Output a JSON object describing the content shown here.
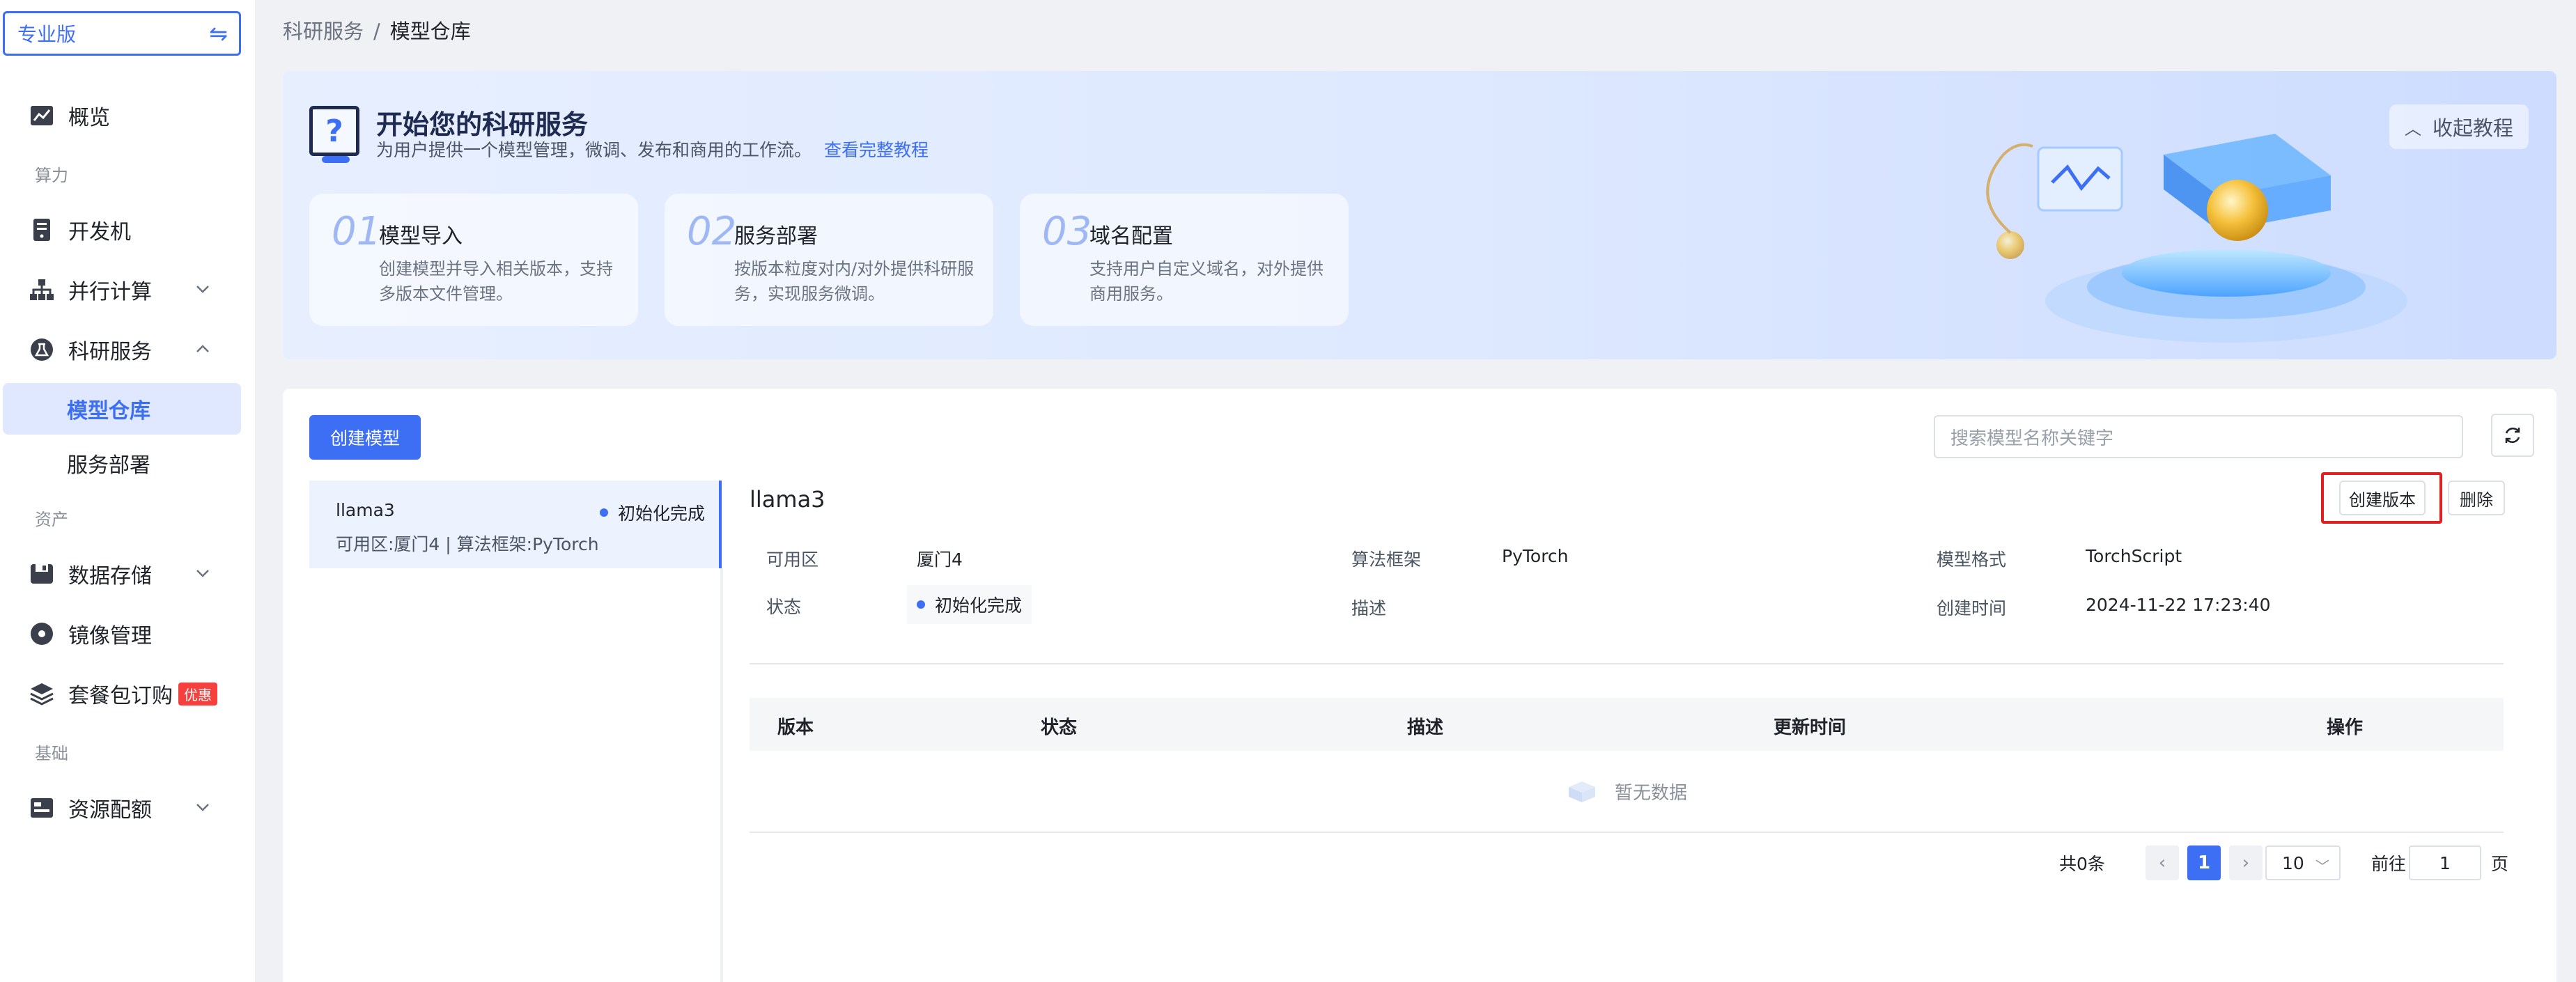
{
  "sidebar": {
    "edition": "专业版",
    "overview": "概览",
    "group_compute": "算力",
    "dev_machine": "开发机",
    "parallel": "并行计算",
    "research": "科研服务",
    "model_repo": "模型仓库",
    "service_deploy": "服务部署",
    "group_assets": "资产",
    "data_storage": "数据存储",
    "image_mgmt": "镜像管理",
    "package": "套餐包订购",
    "package_badge": "优惠",
    "group_basic": "基础",
    "resource_quota": "资源配额"
  },
  "breadcrumb": {
    "parent": "科研服务",
    "sep": "/",
    "current": "模型仓库"
  },
  "banner": {
    "title": "开始您的科研服务",
    "subtitle": "为用户提供一个模型管理，微调、发布和商用的工作流。",
    "tutorial_link": "查看完整教程",
    "collapse": "收起教程",
    "steps": [
      {
        "num": "01",
        "title": "模型导入",
        "desc": "创建模型并导入相关版本，支持多版本文件管理。"
      },
      {
        "num": "02",
        "title": "服务部署",
        "desc": "按版本粒度对内/对外提供科研服务，实现服务微调。"
      },
      {
        "num": "03",
        "title": "域名配置",
        "desc": "支持用户自定义域名，对外提供商用服务。"
      }
    ]
  },
  "toolbar": {
    "create_model": "创建模型",
    "search_placeholder": "搜索模型名称关键字"
  },
  "model_list": [
    {
      "name": "llama3",
      "status": "初始化完成",
      "meta": "可用区:厦门4 | 算法框架:PyTorch"
    }
  ],
  "detail": {
    "title": "llama3",
    "create_version": "创建版本",
    "delete": "删除",
    "zone_label": "可用区",
    "zone": "厦门4",
    "framework_label": "算法框架",
    "framework": "PyTorch",
    "format_label": "模型格式",
    "format": "TorchScript",
    "status_label": "状态",
    "status": "初始化完成",
    "desc_label": "描述",
    "created_label": "创建时间",
    "created": "2024-11-22 17:23:40"
  },
  "table": {
    "columns": [
      "版本",
      "状态",
      "描述",
      "更新时间",
      "操作"
    ],
    "empty": "暂无数据"
  },
  "pagination": {
    "total": "共0条",
    "current": "1",
    "page_size": "10",
    "goto_prefix": "前往",
    "goto_value": "1",
    "goto_suffix": "页"
  },
  "colors": {
    "primary": "#3d6ff5",
    "highlight": "#e02020",
    "badge": "#f5403d"
  }
}
